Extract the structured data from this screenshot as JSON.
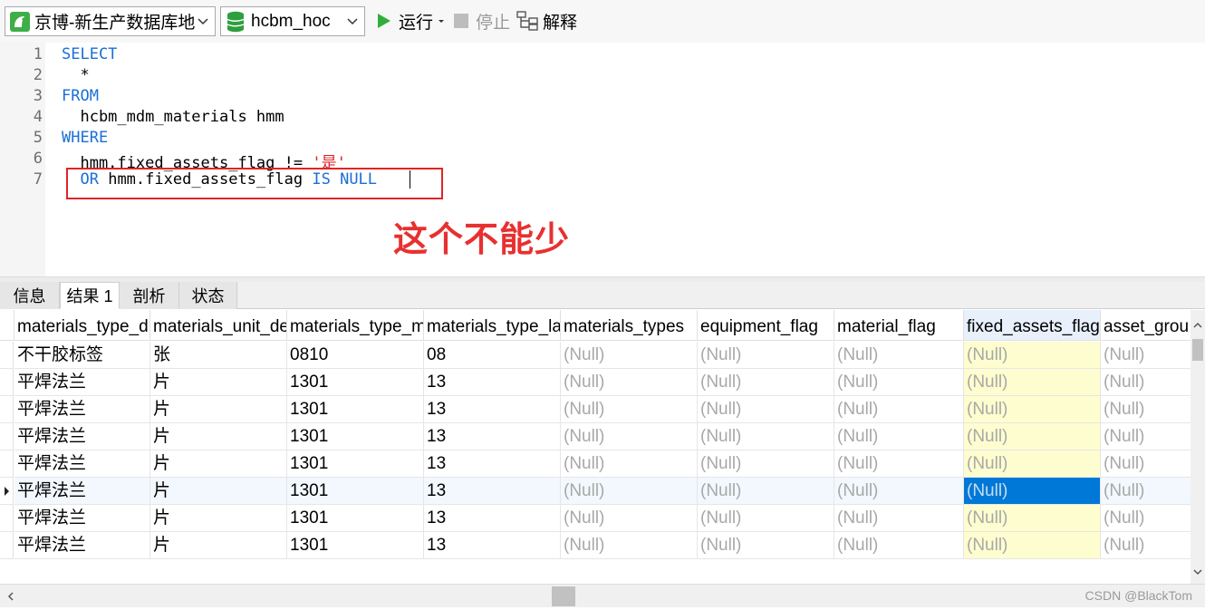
{
  "toolbar": {
    "connection": "京博-新生产数据库地",
    "database": "hcbm_hoc",
    "run_label": "运行",
    "stop_label": "停止",
    "explain_label": "解释"
  },
  "editor": {
    "line_numbers": [
      "1",
      "2",
      "3",
      "4",
      "5",
      "6",
      "7"
    ],
    "lines": [
      {
        "kw": "SELECT",
        "text": "",
        "str": ""
      },
      {
        "kw": "",
        "text": "  *",
        "str": ""
      },
      {
        "kw": "FROM",
        "text": "",
        "str": ""
      },
      {
        "kw": "",
        "text": "  hcbm_mdm_materials hmm",
        "str": ""
      },
      {
        "kw": "WHERE",
        "text": "",
        "str": ""
      },
      {
        "kw": "",
        "text": "  hmm.fixed_assets_flag != ",
        "str": "'是'"
      },
      {
        "kw": "",
        "text": "",
        "str": ""
      }
    ],
    "line7": {
      "kw1": "OR",
      "text": " hmm.fixed_assets_flag ",
      "kw2": "IS NULL"
    },
    "annotation": "这个不能少"
  },
  "tabs": [
    "信息",
    "结果 1",
    "剖析",
    "状态"
  ],
  "active_tab": 1,
  "grid": {
    "columns": [
      "materials_type_d",
      "materials_unit_de",
      "materials_type_m",
      "materials_type_la",
      "materials_types",
      "equipment_flag",
      "material_flag",
      "fixed_assets_flag",
      "asset_grou"
    ],
    "selected_column": 7,
    "rows": [
      [
        "不干胶标签",
        "张",
        "0810",
        "08",
        "(Null)",
        "(Null)",
        "(Null)",
        "(Null)",
        "(Null)"
      ],
      [
        "平焊法兰",
        "片",
        "1301",
        "13",
        "(Null)",
        "(Null)",
        "(Null)",
        "(Null)",
        "(Null)"
      ],
      [
        "平焊法兰",
        "片",
        "1301",
        "13",
        "(Null)",
        "(Null)",
        "(Null)",
        "(Null)",
        "(Null)"
      ],
      [
        "平焊法兰",
        "片",
        "1301",
        "13",
        "(Null)",
        "(Null)",
        "(Null)",
        "(Null)",
        "(Null)"
      ],
      [
        "平焊法兰",
        "片",
        "1301",
        "13",
        "(Null)",
        "(Null)",
        "(Null)",
        "(Null)",
        "(Null)"
      ],
      [
        "平焊法兰",
        "片",
        "1301",
        "13",
        "(Null)",
        "(Null)",
        "(Null)",
        "(Null)",
        "(Null)"
      ],
      [
        "平焊法兰",
        "片",
        "1301",
        "13",
        "(Null)",
        "(Null)",
        "(Null)",
        "(Null)",
        "(Null)"
      ],
      [
        "平焊法兰",
        "片",
        "1301",
        "13",
        "(Null)",
        "(Null)",
        "(Null)",
        "(Null)",
        "(Null)"
      ]
    ],
    "current_row": 5,
    "null_text": "(Null)"
  },
  "watermark": "CSDN @BlackTom",
  "colors": {
    "keyword": "#1a6fd6",
    "string": "#e0202a",
    "annotation": "#e83030",
    "selected_column_bg": "#fdfdcf",
    "selected_cell_bg": "#0078d7",
    "null_text": "#a8a8a8"
  }
}
